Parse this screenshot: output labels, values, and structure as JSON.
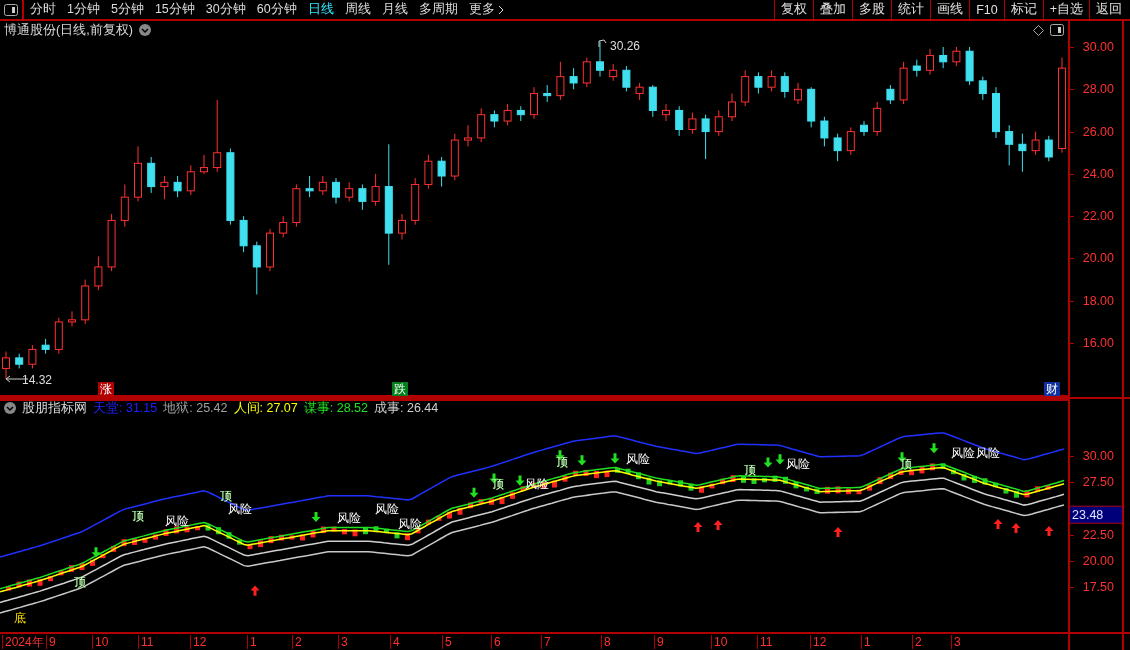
{
  "toolbar": {
    "periods": [
      {
        "label": "分时",
        "selected": false
      },
      {
        "label": "1分钟",
        "selected": false
      },
      {
        "label": "5分钟",
        "selected": false
      },
      {
        "label": "15分钟",
        "selected": false
      },
      {
        "label": "30分钟",
        "selected": false
      },
      {
        "label": "60分钟",
        "selected": false
      },
      {
        "label": "日线",
        "selected": true
      },
      {
        "label": "周线",
        "selected": false
      },
      {
        "label": "月线",
        "selected": false
      },
      {
        "label": "多周期",
        "selected": false
      },
      {
        "label": "更多",
        "selected": false
      }
    ],
    "buttons": [
      "复权",
      "叠加",
      "多股",
      "统计",
      "画线",
      "F10",
      "标记",
      "+自选",
      "返回"
    ]
  },
  "price_panel": {
    "title": "博通股份(日线,前复权)",
    "high_label": "30.26",
    "low_label": "14.32",
    "events": [
      {
        "text": "涨",
        "color": "#b00000"
      },
      {
        "text": "跌",
        "color": "#00801a"
      },
      {
        "text": "财",
        "color": "#1030a0"
      }
    ],
    "chart_data": {
      "type": "candlestick",
      "ylim": [
        13.45,
        31.23
      ],
      "yticks": [
        {
          "value": 30,
          "label": "30.00"
        },
        {
          "value": 28,
          "label": "28.00"
        },
        {
          "value": 26,
          "label": "26.00"
        },
        {
          "value": 24,
          "label": "24.00"
        },
        {
          "value": 22,
          "label": "22.00"
        },
        {
          "value": 20,
          "label": "20.00"
        },
        {
          "value": 18,
          "label": "18.00"
        },
        {
          "value": 16,
          "label": "16.00"
        }
      ],
      "ohlc": [
        [
          14.8,
          15.6,
          14.3,
          15.3
        ],
        [
          15.3,
          15.5,
          14.8,
          15.0
        ],
        [
          15.0,
          15.9,
          14.8,
          15.7
        ],
        [
          15.9,
          16.2,
          15.5,
          15.7
        ],
        [
          15.7,
          17.2,
          15.5,
          17.0
        ],
        [
          17.0,
          17.5,
          16.8,
          17.1
        ],
        [
          17.1,
          19.0,
          16.9,
          18.7
        ],
        [
          18.7,
          20.1,
          18.5,
          19.6
        ],
        [
          19.6,
          22.1,
          19.4,
          21.8
        ],
        [
          21.8,
          23.5,
          21.5,
          22.9
        ],
        [
          22.9,
          25.3,
          22.7,
          24.5
        ],
        [
          24.5,
          24.8,
          23.1,
          23.4
        ],
        [
          23.4,
          23.9,
          22.8,
          23.6
        ],
        [
          23.6,
          23.9,
          22.9,
          23.2
        ],
        [
          23.2,
          24.4,
          23.0,
          24.1
        ],
        [
          24.1,
          24.9,
          24.0,
          24.3
        ],
        [
          24.3,
          27.5,
          24.1,
          25.0
        ],
        [
          25.0,
          25.2,
          21.6,
          21.8
        ],
        [
          21.8,
          22.0,
          20.3,
          20.6
        ],
        [
          20.6,
          20.8,
          18.3,
          19.6
        ],
        [
          19.6,
          21.4,
          19.4,
          21.2
        ],
        [
          21.2,
          22.0,
          21.0,
          21.7
        ],
        [
          21.7,
          23.5,
          21.5,
          23.3
        ],
        [
          23.3,
          23.9,
          22.9,
          23.2
        ],
        [
          23.2,
          23.9,
          23.0,
          23.6
        ],
        [
          23.6,
          23.8,
          22.6,
          22.9
        ],
        [
          22.9,
          23.6,
          22.7,
          23.3
        ],
        [
          23.3,
          23.5,
          22.3,
          22.7
        ],
        [
          22.7,
          24.0,
          22.5,
          23.4
        ],
        [
          23.4,
          25.4,
          19.7,
          21.2
        ],
        [
          21.2,
          22.1,
          20.9,
          21.8
        ],
        [
          21.8,
          23.8,
          21.6,
          23.5
        ],
        [
          23.5,
          24.9,
          23.3,
          24.6
        ],
        [
          24.6,
          24.8,
          23.4,
          23.9
        ],
        [
          23.9,
          25.9,
          23.7,
          25.6
        ],
        [
          25.6,
          26.3,
          25.3,
          25.7
        ],
        [
          25.7,
          27.1,
          25.5,
          26.8
        ],
        [
          26.8,
          27.0,
          26.2,
          26.5
        ],
        [
          26.5,
          27.3,
          26.3,
          27.0
        ],
        [
          27.0,
          27.2,
          26.5,
          26.8
        ],
        [
          26.8,
          28.1,
          26.6,
          27.8
        ],
        [
          27.8,
          28.2,
          27.4,
          27.7
        ],
        [
          27.7,
          29.3,
          27.5,
          28.6
        ],
        [
          28.6,
          29.0,
          28.0,
          28.3
        ],
        [
          28.3,
          29.5,
          28.1,
          29.3
        ],
        [
          29.3,
          30.26,
          28.6,
          28.9
        ],
        [
          28.6,
          29.2,
          28.4,
          28.9
        ],
        [
          28.9,
          29.1,
          27.9,
          28.1
        ],
        [
          27.8,
          28.3,
          27.5,
          28.1
        ],
        [
          28.1,
          28.2,
          26.7,
          27.0
        ],
        [
          26.8,
          27.3,
          26.5,
          27.0
        ],
        [
          27.0,
          27.2,
          25.8,
          26.1
        ],
        [
          26.1,
          26.9,
          25.9,
          26.6
        ],
        [
          26.6,
          26.8,
          24.7,
          26.0
        ],
        [
          26.0,
          27.0,
          25.8,
          26.7
        ],
        [
          26.7,
          27.8,
          26.5,
          27.4
        ],
        [
          27.4,
          28.9,
          27.2,
          28.6
        ],
        [
          28.6,
          28.8,
          27.8,
          28.1
        ],
        [
          28.1,
          28.9,
          27.9,
          28.6
        ],
        [
          28.6,
          28.8,
          27.6,
          27.9
        ],
        [
          27.5,
          28.3,
          27.3,
          28.0
        ],
        [
          28.0,
          28.1,
          26.2,
          26.5
        ],
        [
          26.5,
          26.7,
          25.3,
          25.7
        ],
        [
          25.7,
          25.9,
          24.6,
          25.1
        ],
        [
          25.1,
          26.2,
          24.9,
          26.0
        ],
        [
          26.3,
          26.5,
          25.8,
          26.0
        ],
        [
          26.0,
          27.4,
          25.8,
          27.1
        ],
        [
          28.0,
          28.2,
          27.3,
          27.5
        ],
        [
          27.5,
          29.3,
          27.3,
          29.0
        ],
        [
          29.1,
          29.4,
          28.6,
          28.9
        ],
        [
          28.9,
          29.9,
          28.7,
          29.6
        ],
        [
          29.6,
          30.0,
          29.0,
          29.3
        ],
        [
          29.3,
          30.0,
          29.1,
          29.8
        ],
        [
          29.8,
          30.0,
          28.2,
          28.4
        ],
        [
          28.4,
          28.6,
          27.5,
          27.8
        ],
        [
          27.8,
          28.1,
          25.7,
          26.0
        ],
        [
          26.0,
          26.3,
          24.4,
          25.4
        ],
        [
          25.4,
          25.9,
          24.1,
          25.1
        ],
        [
          25.1,
          26.0,
          24.9,
          25.6
        ],
        [
          25.6,
          25.8,
          24.6,
          24.8
        ],
        [
          25.2,
          29.5,
          25.0,
          29.0
        ]
      ]
    }
  },
  "indicator_panel": {
    "name": "股朋指标网",
    "values": [
      {
        "label": "天堂:",
        "value": "31.15",
        "color": "#2020ff"
      },
      {
        "label": "地狱:",
        "value": "25.42",
        "color": "#a0a0a0"
      },
      {
        "label": "人间:",
        "value": "27.07",
        "color": "#ffff00"
      },
      {
        "label": "谋事:",
        "value": "28.52",
        "color": "#20e020"
      },
      {
        "label": "成事:",
        "value": "26.44",
        "color": "#d0d0d0"
      }
    ],
    "signals": [
      {
        "kind": "bottom",
        "text": "底"
      },
      {
        "kind": "top",
        "text": "顶"
      },
      {
        "kind": "top",
        "text": "顶"
      },
      {
        "kind": "risk",
        "text": "风险"
      },
      {
        "kind": "top",
        "text": "顶"
      },
      {
        "kind": "risk",
        "text": "风险"
      },
      {
        "kind": "risk",
        "text": "风险"
      },
      {
        "kind": "risk",
        "text": "风险"
      },
      {
        "kind": "risk",
        "text": "风险"
      },
      {
        "kind": "top",
        "text": "顶"
      },
      {
        "kind": "risk",
        "text": "风险"
      },
      {
        "kind": "top",
        "text": "顶"
      },
      {
        "kind": "risk",
        "text": "风险"
      },
      {
        "kind": "top",
        "text": "顶"
      },
      {
        "kind": "risk",
        "text": "风险"
      },
      {
        "kind": "top",
        "text": "顶"
      },
      {
        "kind": "risk",
        "text": "风险"
      },
      {
        "kind": "risk",
        "text": "风险"
      }
    ],
    "chart_data": {
      "type": "line",
      "ylim": [
        13.4,
        35.48
      ],
      "yticks": [
        {
          "value": 30,
          "label": "30.00"
        },
        {
          "value": 27.5,
          "label": "27.50"
        },
        {
          "value": 22.5,
          "label": "22.50"
        },
        {
          "value": 20,
          "label": "20.00"
        },
        {
          "value": 17.5,
          "label": "17.50"
        }
      ],
      "series": [
        {
          "color": "#2030ff",
          "values": [
            20.5,
            21.6,
            22.9,
            25.0,
            26.0,
            26.8,
            24.9,
            25.6,
            26.3,
            26.3,
            25.9,
            28.1,
            29.1,
            30.4,
            31.5,
            32.0,
            31.0,
            30.3,
            31.2,
            31.1,
            30.0,
            30.1,
            31.9,
            32.3,
            30.8,
            29.7,
            30.8
          ]
        },
        {
          "color": "#20e020",
          "values": [
            17.5,
            18.6,
            19.9,
            22.0,
            23.0,
            23.8,
            21.9,
            22.6,
            23.3,
            23.3,
            22.9,
            25.1,
            26.1,
            27.4,
            28.5,
            29.0,
            28.0,
            27.3,
            28.2,
            28.1,
            27.0,
            27.1,
            28.9,
            29.3,
            27.8,
            26.7,
            27.8
          ]
        },
        {
          "color": "#ffff00",
          "values": [
            17.2,
            18.3,
            19.6,
            21.7,
            22.7,
            23.5,
            21.6,
            22.3,
            23.0,
            23.0,
            22.6,
            24.8,
            25.8,
            27.1,
            28.2,
            28.7,
            27.7,
            27.0,
            27.9,
            27.8,
            26.7,
            26.8,
            28.6,
            29.0,
            27.5,
            26.4,
            27.5
          ]
        },
        {
          "color": "#d0d0d0",
          "values": [
            16.2,
            17.3,
            18.6,
            20.7,
            21.7,
            22.5,
            20.6,
            21.3,
            22.0,
            22.0,
            21.6,
            23.8,
            24.8,
            26.1,
            27.2,
            27.7,
            26.7,
            26.0,
            26.9,
            26.8,
            25.7,
            25.8,
            27.6,
            28.0,
            26.5,
            25.4,
            26.5
          ]
        },
        {
          "color": "#c8c8c8",
          "values": [
            15.2,
            16.3,
            17.6,
            19.7,
            20.7,
            21.5,
            19.6,
            20.3,
            21.0,
            21.0,
            20.6,
            22.8,
            23.8,
            25.1,
            26.2,
            26.7,
            25.7,
            25.0,
            25.9,
            25.8,
            24.7,
            24.8,
            26.6,
            27.0,
            25.5,
            24.4,
            25.5
          ]
        }
      ]
    },
    "current": "23.48"
  },
  "time_axis": [
    "2024年",
    "9",
    "10",
    "11",
    "12",
    "1",
    "2",
    "3",
    "4",
    "5",
    "6",
    "7",
    "8",
    "9",
    "10",
    "11",
    "12",
    "1",
    "2",
    "3"
  ]
}
